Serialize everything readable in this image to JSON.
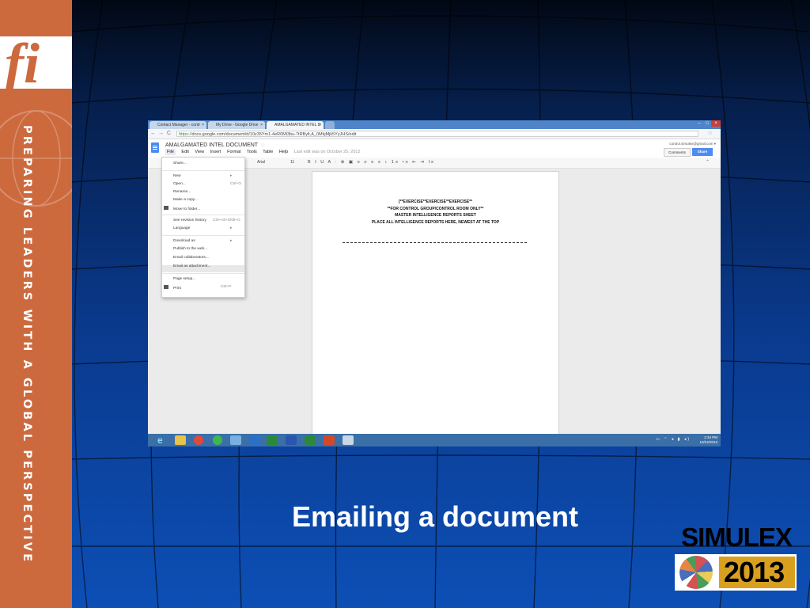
{
  "slide": {
    "logo": "fi",
    "tagline": "PREPARING LEADERS WITH A GLOBAL PERSPECTIVE",
    "caption": "Emailing a document",
    "brand": "SIMULEX",
    "year": "2013"
  },
  "browser": {
    "tabs": [
      {
        "label": "Contact Manager - contr",
        "close": "×"
      },
      {
        "label": "My Drive - Google Drive",
        "close": "×"
      },
      {
        "label": "AMALGAMATED INTEL D",
        "close": "×"
      }
    ],
    "window_buttons": [
      "–",
      "□",
      "×"
    ],
    "url_secure": "https://",
    "url": "docs.google.com/document/d/10z35Ym1-4eR0Ml3bu-7tRBylt,A_0MkjMjk5YyJHS/edit",
    "back": "←",
    "forward": "→",
    "reload": "C",
    "star": "☆"
  },
  "docs": {
    "title": "AMALGAMATED INTEL DOCUMENT",
    "title_star": "☆",
    "menus": [
      "File",
      "Edit",
      "View",
      "Insert",
      "Format",
      "Tools",
      "Table",
      "Help"
    ],
    "last_edit": "Last edit was on October 25, 2012",
    "account": "control.simulex@gmail.com ▾",
    "comments_label": "Comments",
    "share_label": "Share",
    "font": "Arial",
    "font_size": "11",
    "toolbar_icons": "B I U A · ⊕ ▣ ≡ ≡ ≡ ≡ ↕ 1≡ •≡ ⇤ ⇥ Ix",
    "collapse": "⌃"
  },
  "file_menu": {
    "items": [
      {
        "label": "Share...",
        "shortcut": ""
      },
      {
        "label": "New",
        "shortcut": "▸"
      },
      {
        "label": "Open...",
        "shortcut": "Ctrl+O"
      },
      {
        "label": "Rename...",
        "shortcut": ""
      },
      {
        "label": "Make a copy...",
        "shortcut": ""
      },
      {
        "label": "Move to folder...",
        "shortcut": ""
      },
      {
        "label": "See revision history",
        "shortcut": "Ctrl+Alt+Shift+G"
      },
      {
        "label": "Language",
        "shortcut": "▸"
      },
      {
        "label": "Download as",
        "shortcut": "▸"
      },
      {
        "label": "Publish to the web...",
        "shortcut": ""
      },
      {
        "label": "Email collaborators...",
        "shortcut": ""
      },
      {
        "label": "Email as attachment...",
        "shortcut": ""
      },
      {
        "label": "Page setup...",
        "shortcut": ""
      },
      {
        "label": "Print",
        "shortcut": "Ctrl+P"
      }
    ],
    "highlighted": "Email as attachment..."
  },
  "document": {
    "lines": [
      "[**EXERCISE**EXERCISE**EXERCISE**",
      "**FOR CONTROL GROUP/CONTROL ROOM ONLY**",
      "MASTER INTELLIGENCE REPORTS SHEET",
      "PLACE ALL INTELLIGENCE REPORTS HERE, NEWEST AT THE TOP"
    ]
  },
  "taskbar": {
    "ie_icon": "e",
    "apps": [
      "file-explorer-icon",
      "chrome-icon",
      "spotify-icon",
      "monitor-icon",
      "outlook-icon",
      "excel-icon",
      "word-icon",
      "excel-icon",
      "powerpoint-icon",
      "paint-icon"
    ],
    "tray": "▭ ⌃ ◂ ▮ ◂)",
    "time": "2:34 PM",
    "date": "10/24/2013"
  }
}
